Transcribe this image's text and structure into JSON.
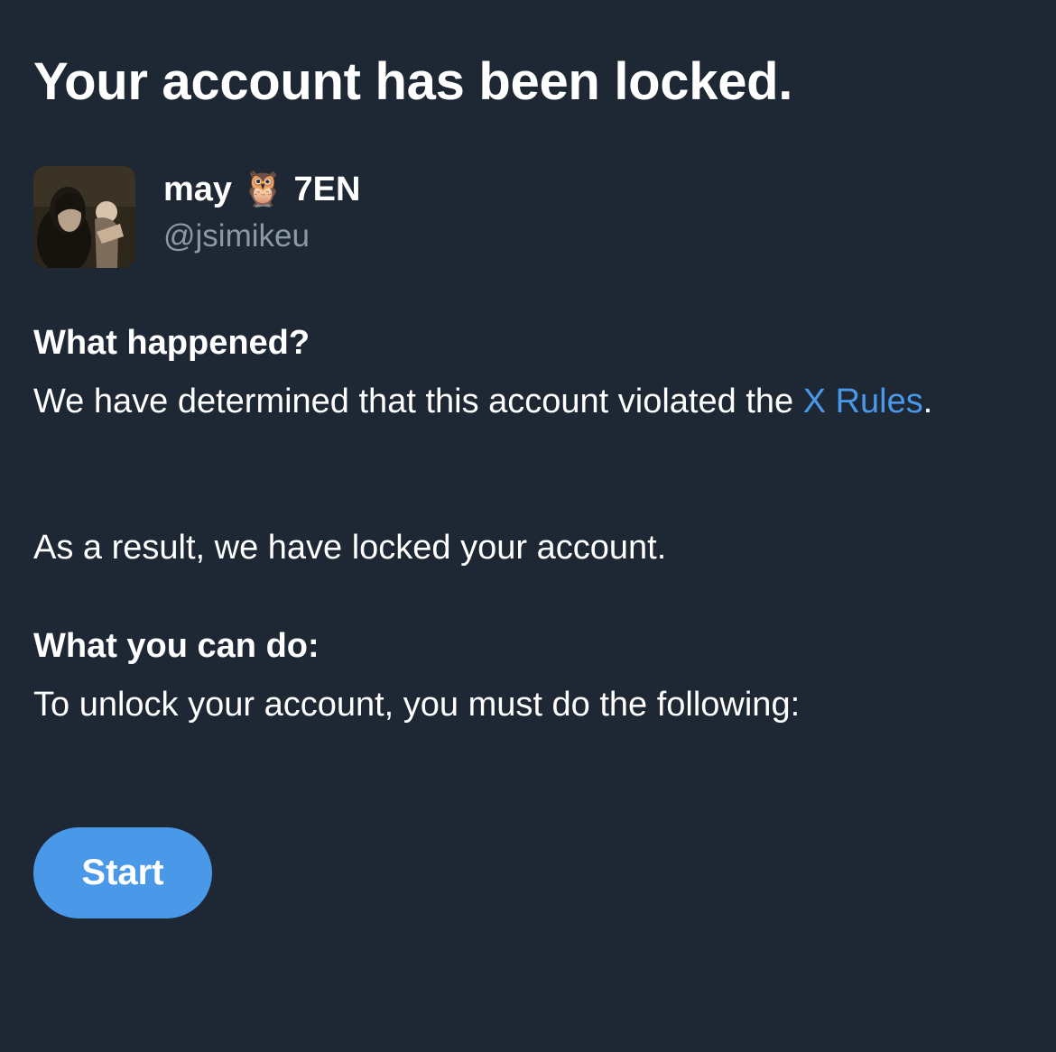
{
  "page": {
    "title": "Your account has been locked."
  },
  "profile": {
    "display_name": "may 🦉 7EN",
    "handle": "@jsimikeu",
    "avatar_icon": "profile-photo"
  },
  "what_happened": {
    "heading": "What happened?",
    "text_before_link": "We have determined that this account violated the ",
    "link_label": "X Rules",
    "text_after_link": ".",
    "result_text": "As a result, we have locked your account."
  },
  "what_you_can_do": {
    "heading": "What you can do:",
    "text": "To unlock your account, you must do the following:"
  },
  "actions": {
    "start_label": "Start"
  },
  "colors": {
    "background": "#1e2734",
    "accent": "#4a99e9",
    "secondary_text": "#8b98a5",
    "primary_text": "#ffffff"
  }
}
